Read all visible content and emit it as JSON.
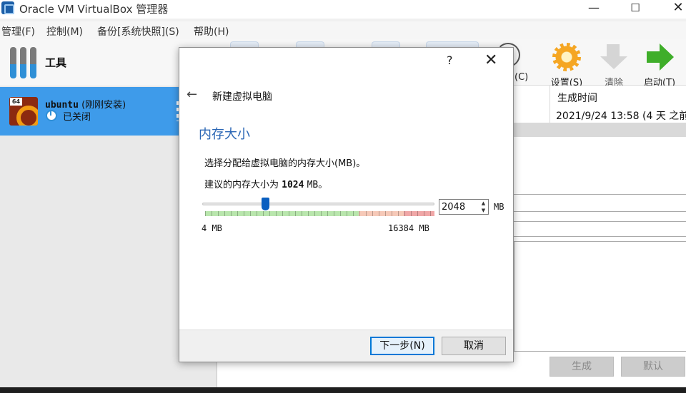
{
  "window": {
    "title": "Oracle VM VirtualBox 管理器",
    "min_icon": "minimize-icon",
    "max_icon": "maximize-icon",
    "close_icon": "close-icon",
    "min_glyph": "—",
    "max_glyph": "☐",
    "close_glyph": "✕"
  },
  "menu": [
    "管理(F)",
    "控制(M)",
    "备份[系统快照](S)",
    "帮助(H)"
  ],
  "sidebar": {
    "tools_label": "工具",
    "vm": {
      "os_badge": "64",
      "name": "ubuntu",
      "note": "(刚刚安装)",
      "state": "已关闭"
    }
  },
  "toolbar": {
    "partial_label": "(C)",
    "settings_label": "设置(S)",
    "discard_label": "清除",
    "start_label": "启动(T)"
  },
  "details": {
    "column_title": "生成时间",
    "column_value": "2021/9/24 13:58 (4 天 之前",
    "generate_label": "生成",
    "default_label": "默认"
  },
  "dialog": {
    "help": "?",
    "close_glyph": "✕",
    "back_glyph": "←",
    "title": "新建虚拟电脑",
    "heading": "内存大小",
    "description": "选择分配给虚拟电脑的内存大小(MB)。",
    "recommend_prefix": "建议的内存大小为",
    "recommend_value": "1024",
    "recommend_unit": "MB。",
    "memory": {
      "value": "2048",
      "unit": "MB",
      "min_label": "4 MB",
      "max_label": "16384 MB",
      "min": 4,
      "max": 16384,
      "current": 2048,
      "green_until": 10970,
      "orange_until": 14200
    },
    "next_label": "下一步(N)",
    "cancel_label": "取消"
  },
  "colors": {
    "accent": "#2a66b5",
    "selection": "#3e9bea",
    "slider_handle": "#0a5fc0",
    "default_button_border": "#0078d7"
  }
}
